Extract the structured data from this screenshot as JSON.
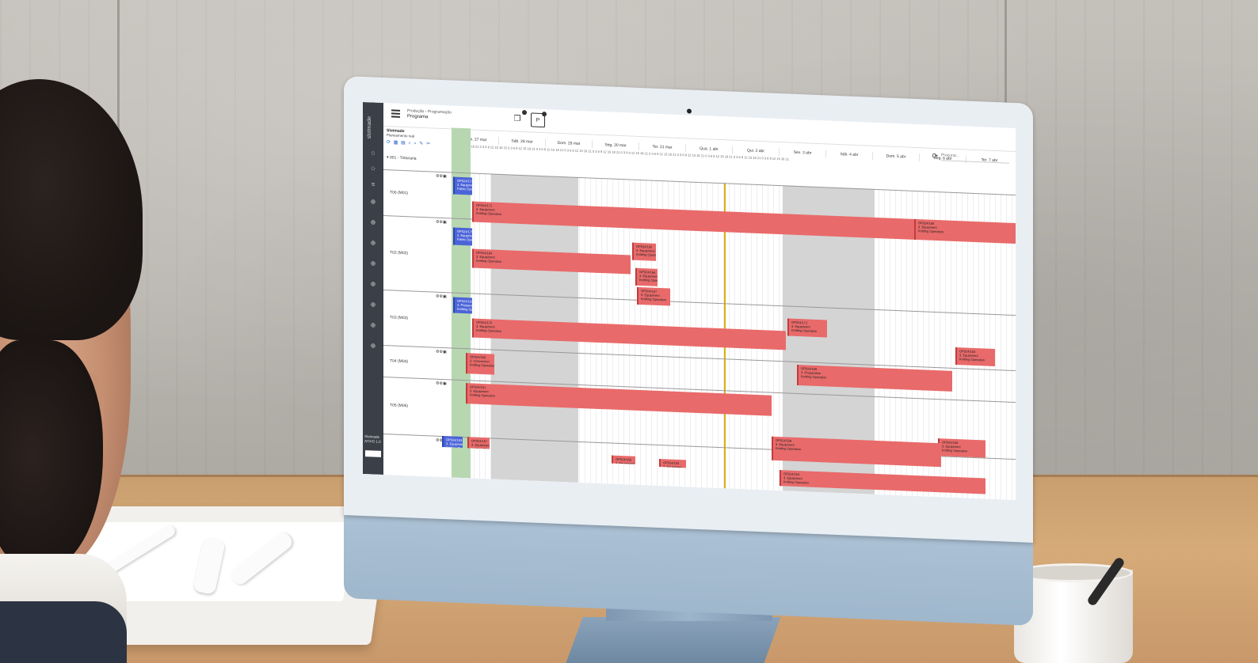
{
  "app": {
    "brand": "slotmade",
    "breadcrumb": "Produção › Programação",
    "page_title": "Programa",
    "toolbar_p_label": "P",
    "search_placeholder": "Procurar..."
  },
  "header": {
    "view_title": "Slotmade",
    "view_subtitle": "Planeamento real",
    "tool_glyphs": "⟳ ▦ ▤ ⌕ ⌕ ✎ ✂",
    "group_label": "▾ 001 - Tinturaria",
    "hours_label": "0 3 6 9 12 15 18 21 0 3 6 9 12 15 18 21 0 3 6 9 12 15 18 21 0 3 6 9 12 15 18 21 0 3 6 9 12 15 18 21 0 3 6 9 12 15 18 21 0 3 6 9 12 15 18 21 0 3 6 9 12 15 18 21 0 3 6 9 12 15 18 21 0 3 6 9 12 15 18 21 0 3 6 9 12 15 18 21 0 3 6 9 12 15 18 21"
  },
  "days": [
    "Dom. 27 mar",
    "Sáb. 28 mar",
    "Dom. 29 mar",
    "Seg. 30 mar",
    "Ter. 31 mar",
    "Qua. 1 abr",
    "Qui. 2 abr",
    "Sex. 3 abr",
    "Sáb. 4 abr",
    "Dom. 5 abr",
    "Seg. 6 abr",
    "Ter. 7 abr"
  ],
  "rows": [
    {
      "label": "T06 (M01)"
    },
    {
      "label": "T02 (M02)"
    },
    {
      "label": "T03 (M03)"
    },
    {
      "label": "T04 (M04)"
    },
    {
      "label": "T05 (M05)"
    },
    {
      "label": ""
    }
  ],
  "jobs": [
    {
      "l1": "OP024/173",
      "l2": "3. Equipment",
      "l3": "Fabric Dye and Toning"
    },
    {
      "l1": "OP024/172",
      "l2": "3. Equipment",
      "l3": "Knitting Operation"
    },
    {
      "l1": "OP024/168",
      "l2": "3. Equipment",
      "l3": "Knitting Operation"
    },
    {
      "l1": "OP024/175",
      "l2": "3. Equipment",
      "l3": "Fabric Dye and Toning"
    },
    {
      "l1": "OP024/164",
      "l2": "3. Equipment",
      "l3": "Knitting Operation"
    },
    {
      "l1": "OP024/165",
      "l2": "3. Equipment",
      "l3": "Knitting Operation"
    },
    {
      "l1": "OP024/166",
      "l2": "3. Equipment",
      "l3": "Knitting Operation"
    },
    {
      "l1": "OP024/167",
      "l2": "3. Equipment",
      "l3": "Knitting Operation"
    },
    {
      "l1": "OP024/162",
      "l2": "3. Preparation",
      "l3": "Knitting Operation"
    },
    {
      "l1": "OP024/170",
      "l2": "3. Equipment",
      "l3": "Knitting Operation"
    },
    {
      "l1": "OP024/171",
      "l2": "3. Equipment",
      "l3": "Knitting Operation"
    },
    {
      "l1": "OP024/163",
      "l2": "3. Equipment",
      "l3": "Knitting Operation"
    },
    {
      "l1": "OP024/160",
      "l2": "3. Conversion",
      "l3": "Knitting Operation"
    },
    {
      "l1": "OP024/169",
      "l2": "3. Preparation",
      "l3": "Knitting Operation"
    },
    {
      "l1": "OP024/161",
      "l2": "3. Equipment",
      "l3": "Knitting Operation"
    },
    {
      "l1": "OP024/158",
      "l2": "3. Equipment",
      "l3": "Knitting Operation"
    },
    {
      "l1": "OP024/159",
      "l2": "3. Equipment",
      "l3": "Knitting Operation"
    },
    {
      "l1": "OP024/157",
      "l2": "3. Equipment",
      "l3": "Knitting Operation"
    },
    {
      "l1": "OP024/156",
      "l2": "3. Equipment",
      "l3": "Knitting Operation"
    },
    {
      "l1": "OP024/155",
      "l2": "3. Equipment",
      "l3": "Knitting Operation"
    },
    {
      "l1": "OP024/154",
      "l2": "3. Equipment",
      "l3": "Knitting Operation"
    },
    {
      "l1": "OP024/153",
      "l2": "3. Equipment",
      "l3": "Knitting Operation"
    }
  ],
  "sidebar_footer": "Slotmade ATIVO 1.0",
  "colors": {
    "job": "#e96a6a",
    "job_selected": "#4b64d8",
    "today": "#b7d7b1",
    "now_marker": "#d9b20f",
    "weekend": "#d4d4d4",
    "sidebar": "#3b3f47"
  }
}
